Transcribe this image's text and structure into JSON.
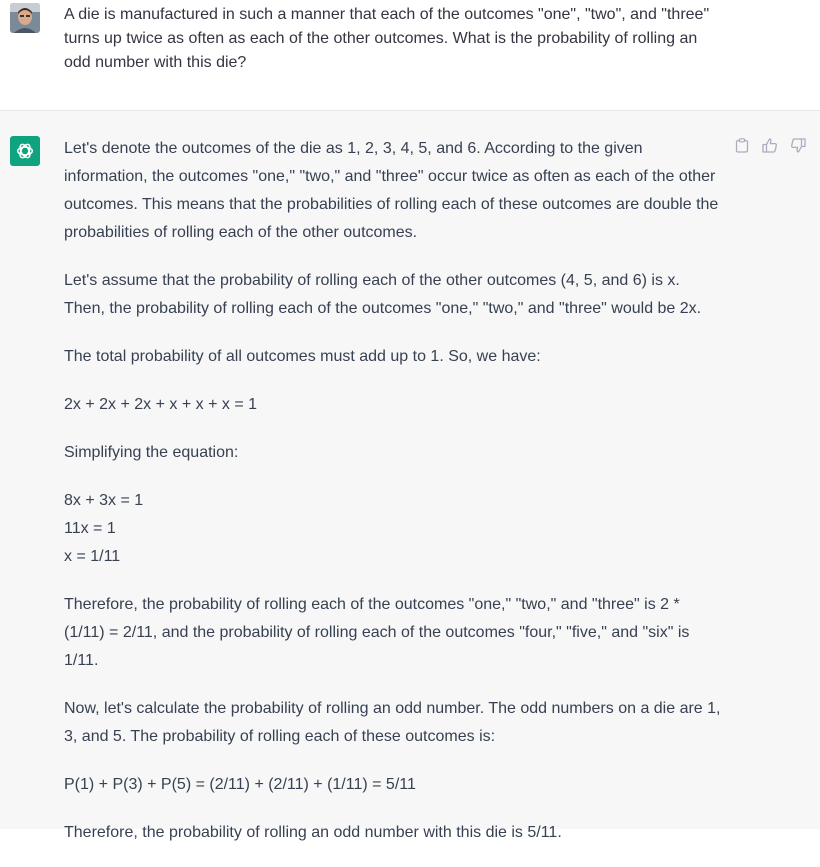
{
  "user": {
    "message": "A die is manufactured in such a manner that each of the outcomes \"one\", \"two\", and \"three\" turns up twice as often as each of the other outcomes. What is the probability of rolling an odd number with this die?"
  },
  "assistant": {
    "paragraphs": [
      "Let's denote the outcomes of the die as 1, 2, 3, 4, 5, and 6. According to the given information, the outcomes \"one,\" \"two,\" and \"three\" occur twice as often as each of the other outcomes. This means that the probabilities of rolling each of these outcomes are double the probabilities of rolling each of the other outcomes.",
      "Let's assume that the probability of rolling each of the other outcomes (4, 5, and 6) is x. Then, the probability of rolling each of the outcomes \"one,\" \"two,\" and \"three\" would be 2x.",
      "The total probability of all outcomes must add up to 1. So, we have:",
      "2x + 2x + 2x + x + x + x = 1",
      "Simplifying the equation:",
      "8x + 3x = 1",
      "11x = 1",
      "x = 1/11",
      "Therefore, the probability of rolling each of the outcomes \"one,\" \"two,\" and \"three\" is 2 * (1/11) = 2/11, and the probability of rolling each of the outcomes \"four,\" \"five,\" and \"six\" is 1/11.",
      "Now, let's calculate the probability of rolling an odd number. The odd numbers on a die are 1, 3, and 5. The probability of rolling each of these outcomes is:",
      "P(1) + P(3) + P(5) = (2/11) + (2/11) + (1/11) = 5/11",
      "Therefore, the probability of rolling an odd number with this die is 5/11."
    ]
  },
  "icons": {
    "copy": "clipboard-icon",
    "like": "thumbs-up-icon",
    "dislike": "thumbs-down-icon",
    "bot": "openai-logo-icon"
  },
  "colors": {
    "accent": "#10a37f",
    "assistant_bg": "#f7f7f8"
  }
}
